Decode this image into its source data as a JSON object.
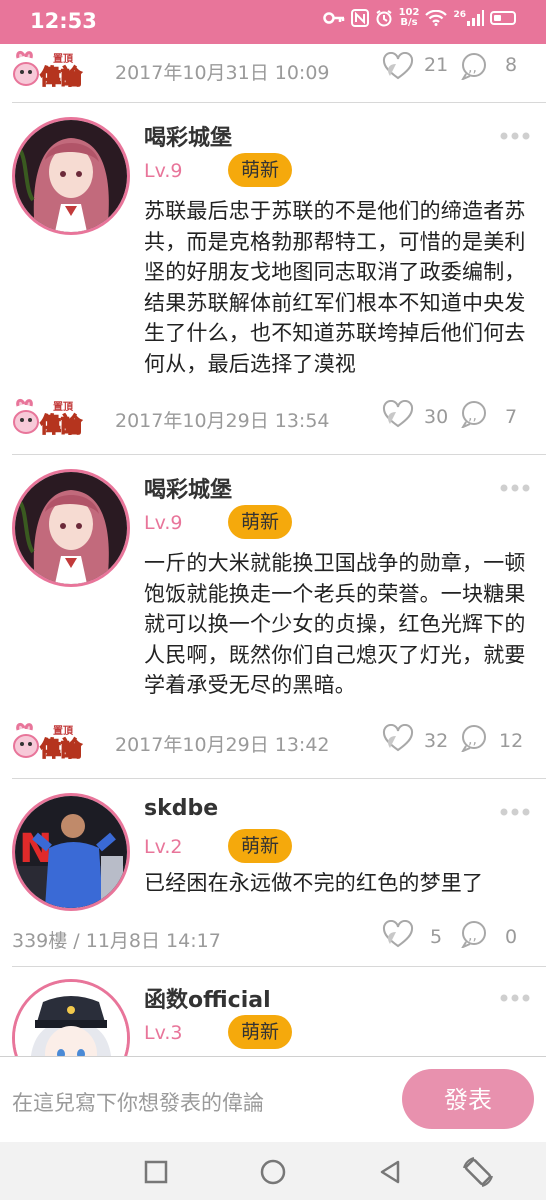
{
  "status_bar": {
    "time": "12:53",
    "net_speed_value": "102",
    "net_speed_unit": "B/s",
    "signal_label": "26",
    "icons": [
      "key-icon",
      "nfc-icon",
      "alarm-icon",
      "wifi-icon",
      "signal-icon",
      "battery-icon"
    ]
  },
  "pin_badge": {
    "top_text": "置頂",
    "main_text": "偉論"
  },
  "top_meta": {
    "date": "2017年10月31日 10:09",
    "likes": "21",
    "comments": "8"
  },
  "posts": [
    {
      "username": "喝彩城堡",
      "level": "Lv.9",
      "tag": "萌新",
      "content": "苏联最后忠于苏联的不是他们的缔造者苏共，而是克格勃那帮特工，可惜的是美利坚的好朋友戈地图同志取消了政委编制，结果苏联解体前红军们根本不知道中央发生了什么，也不知道苏联垮掉后他们何去何从，最后选择了漠视",
      "date": "2017年10月29日 13:54",
      "likes": "30",
      "comments": "7"
    },
    {
      "username": "喝彩城堡",
      "level": "Lv.9",
      "tag": "萌新",
      "content": "一斤的大米就能换卫国战争的勋章，一顿饱饭就能换走一个老兵的荣誉。一块糖果就可以换一个少女的贞操，红色光辉下的人民啊，既然你们自己熄灭了灯光，就要学着承受无尽的黑暗。",
      "date": "2017年10月29日 13:42",
      "likes": "32",
      "comments": "12"
    },
    {
      "username": "skdbe",
      "level": "Lv.2",
      "tag": "萌新",
      "content": "已经困在永远做不完的红色的梦里了",
      "floor": "339樓 / 11月8日 14:17",
      "likes": "5",
      "comments": "0"
    },
    {
      "username": "函数official",
      "level": "Lv.3",
      "tag": "萌新"
    }
  ],
  "input_bar": {
    "placeholder": "在這兒寫下你想發表的偉論",
    "post_label": "發表"
  },
  "colors": {
    "accent": "#e8759a",
    "tag": "#f5a90c",
    "meta_text": "#9a9a9a"
  }
}
